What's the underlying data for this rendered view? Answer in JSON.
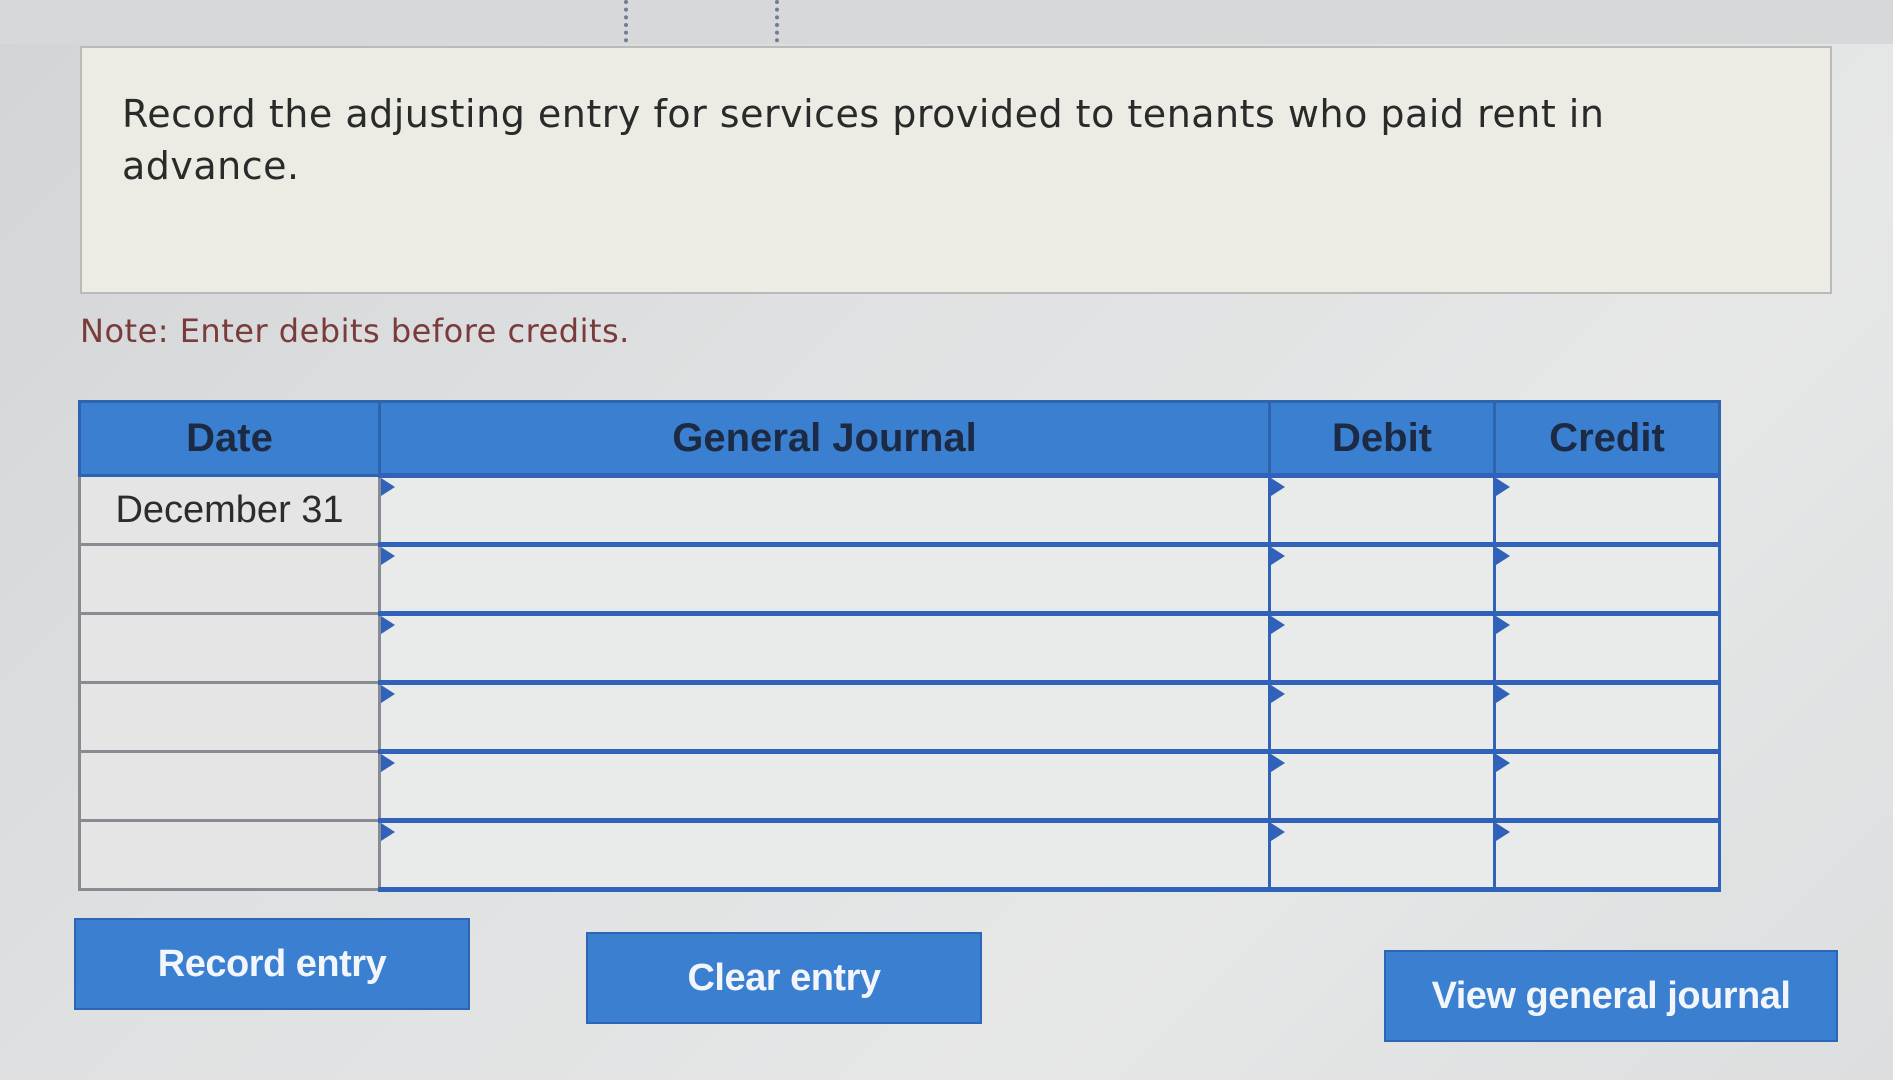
{
  "question": {
    "text": "Record the adjusting entry for services provided to tenants who paid rent in advance."
  },
  "note": "Note: Enter debits before credits.",
  "journal": {
    "headers": {
      "date": "Date",
      "general_journal": "General Journal",
      "debit": "Debit",
      "credit": "Credit"
    },
    "rows": [
      {
        "date": "December 31",
        "account": "",
        "debit": "",
        "credit": ""
      },
      {
        "date": "",
        "account": "",
        "debit": "",
        "credit": ""
      },
      {
        "date": "",
        "account": "",
        "debit": "",
        "credit": ""
      },
      {
        "date": "",
        "account": "",
        "debit": "",
        "credit": ""
      },
      {
        "date": "",
        "account": "",
        "debit": "",
        "credit": ""
      },
      {
        "date": "",
        "account": "",
        "debit": "",
        "credit": ""
      }
    ]
  },
  "buttons": {
    "record": "Record entry",
    "clear": "Clear entry",
    "view": "View general journal"
  },
  "colors": {
    "accent_blue": "#3a7fd0",
    "border_blue": "#2f62b8",
    "note_red": "#7a3b3b"
  }
}
